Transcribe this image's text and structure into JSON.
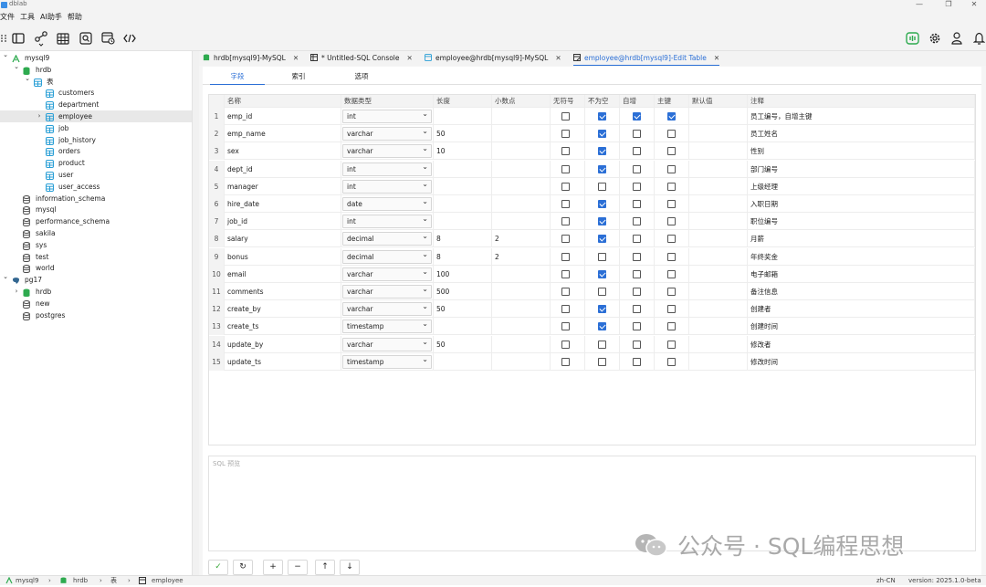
{
  "app": {
    "title": "dblab"
  },
  "window": {
    "minimize": "—",
    "maximize": "❐",
    "close": "✕"
  },
  "menu": [
    "文件",
    "工具",
    "AI助手",
    "帮助"
  ],
  "toolbar_icons": [
    "layout-icon",
    "connection-icon",
    "table-icon",
    "query-icon",
    "export-icon",
    "code-icon"
  ],
  "right_icons": [
    "ai-icon",
    "gear-icon",
    "user-icon",
    "bell-icon"
  ],
  "tree": [
    {
      "label": "mysql9",
      "level": 0,
      "arrow": "down",
      "icon": "connection"
    },
    {
      "label": "hrdb",
      "level": 1,
      "arrow": "down",
      "icon": "database"
    },
    {
      "label": "表",
      "level": 2,
      "arrow": "down",
      "icon": "table"
    },
    {
      "label": "customers",
      "level": 3,
      "arrow": "",
      "icon": "table"
    },
    {
      "label": "department",
      "level": 3,
      "arrow": "",
      "icon": "table"
    },
    {
      "label": "employee",
      "level": 3,
      "arrow": "right",
      "icon": "table",
      "selected": true
    },
    {
      "label": "job",
      "level": 3,
      "arrow": "",
      "icon": "table"
    },
    {
      "label": "job_history",
      "level": 3,
      "arrow": "",
      "icon": "table"
    },
    {
      "label": "orders",
      "level": 3,
      "arrow": "",
      "icon": "table"
    },
    {
      "label": "product",
      "level": 3,
      "arrow": "",
      "icon": "table"
    },
    {
      "label": "user",
      "level": 3,
      "arrow": "",
      "icon": "table"
    },
    {
      "label": "user_access",
      "level": 3,
      "arrow": "",
      "icon": "table"
    },
    {
      "label": "information_schema",
      "level": 1,
      "arrow": "",
      "icon": "db-gray"
    },
    {
      "label": "mysql",
      "level": 1,
      "arrow": "",
      "icon": "db-gray"
    },
    {
      "label": "performance_schema",
      "level": 1,
      "arrow": "",
      "icon": "db-gray"
    },
    {
      "label": "sakila",
      "level": 1,
      "arrow": "",
      "icon": "db-gray"
    },
    {
      "label": "sys",
      "level": 1,
      "arrow": "",
      "icon": "db-gray"
    },
    {
      "label": "test",
      "level": 1,
      "arrow": "",
      "icon": "db-gray"
    },
    {
      "label": "world",
      "level": 1,
      "arrow": "",
      "icon": "db-gray"
    },
    {
      "label": "pg17",
      "level": 0,
      "arrow": "down",
      "icon": "pg"
    },
    {
      "label": "hrdb",
      "level": 1,
      "arrow": "right",
      "icon": "database"
    },
    {
      "label": "new",
      "level": 1,
      "arrow": "",
      "icon": "db-gray"
    },
    {
      "label": "postgres",
      "level": 1,
      "arrow": "",
      "icon": "db-gray"
    }
  ],
  "tabs": [
    {
      "label": "hrdb[mysql9]-MySQL",
      "icon": "database",
      "active": false
    },
    {
      "label": "* Untitled-SQL Console",
      "icon": "console",
      "active": false
    },
    {
      "label": "employee@hrdb[mysql9]-MySQL",
      "icon": "table",
      "active": false
    },
    {
      "label": "employee@hrdb[mysql9]-Edit Table",
      "icon": "edit",
      "active": true
    }
  ],
  "subtabs": [
    "字段",
    "索引",
    "选项"
  ],
  "columns": [
    "名称",
    "数据类型",
    "长度",
    "小数点",
    "无符号",
    "不为空",
    "自增",
    "主键",
    "默认值",
    "注释"
  ],
  "fields": [
    {
      "n": "1",
      "name": "emp_id",
      "type": "int",
      "len": "",
      "dec": "",
      "uns": false,
      "nn": true,
      "ai": true,
      "pk": true,
      "def": "",
      "comment": "员工编号，自增主键"
    },
    {
      "n": "2",
      "name": "emp_name",
      "type": "varchar",
      "len": "50",
      "dec": "",
      "uns": false,
      "nn": true,
      "ai": false,
      "pk": false,
      "def": "",
      "comment": "员工姓名"
    },
    {
      "n": "3",
      "name": "sex",
      "type": "varchar",
      "len": "10",
      "dec": "",
      "uns": false,
      "nn": true,
      "ai": false,
      "pk": false,
      "def": "",
      "comment": "性别"
    },
    {
      "n": "4",
      "name": "dept_id",
      "type": "int",
      "len": "",
      "dec": "",
      "uns": false,
      "nn": true,
      "ai": false,
      "pk": false,
      "def": "",
      "comment": "部门编号"
    },
    {
      "n": "5",
      "name": "manager",
      "type": "int",
      "len": "",
      "dec": "",
      "uns": false,
      "nn": false,
      "ai": false,
      "pk": false,
      "def": "",
      "comment": "上级经理"
    },
    {
      "n": "6",
      "name": "hire_date",
      "type": "date",
      "len": "",
      "dec": "",
      "uns": false,
      "nn": true,
      "ai": false,
      "pk": false,
      "def": "",
      "comment": "入职日期"
    },
    {
      "n": "7",
      "name": "job_id",
      "type": "int",
      "len": "",
      "dec": "",
      "uns": false,
      "nn": true,
      "ai": false,
      "pk": false,
      "def": "",
      "comment": "职位编号"
    },
    {
      "n": "8",
      "name": "salary",
      "type": "decimal",
      "len": "8",
      "dec": "2",
      "uns": false,
      "nn": true,
      "ai": false,
      "pk": false,
      "def": "",
      "comment": "月薪"
    },
    {
      "n": "9",
      "name": "bonus",
      "type": "decimal",
      "len": "8",
      "dec": "2",
      "uns": false,
      "nn": false,
      "ai": false,
      "pk": false,
      "def": "",
      "comment": "年终奖金"
    },
    {
      "n": "10",
      "name": "email",
      "type": "varchar",
      "len": "100",
      "dec": "",
      "uns": false,
      "nn": true,
      "ai": false,
      "pk": false,
      "def": "",
      "comment": "电子邮箱"
    },
    {
      "n": "11",
      "name": "comments",
      "type": "varchar",
      "len": "500",
      "dec": "",
      "uns": false,
      "nn": false,
      "ai": false,
      "pk": false,
      "def": "",
      "comment": "备注信息"
    },
    {
      "n": "12",
      "name": "create_by",
      "type": "varchar",
      "len": "50",
      "dec": "",
      "uns": false,
      "nn": true,
      "ai": false,
      "pk": false,
      "def": "",
      "comment": "创建者"
    },
    {
      "n": "13",
      "name": "create_ts",
      "type": "timestamp",
      "len": "",
      "dec": "",
      "uns": false,
      "nn": true,
      "ai": false,
      "pk": false,
      "def": "",
      "comment": "创建时间"
    },
    {
      "n": "14",
      "name": "update_by",
      "type": "varchar",
      "len": "50",
      "dec": "",
      "uns": false,
      "nn": false,
      "ai": false,
      "pk": false,
      "def": "",
      "comment": "修改者"
    },
    {
      "n": "15",
      "name": "update_ts",
      "type": "timestamp",
      "len": "",
      "dec": "",
      "uns": false,
      "nn": false,
      "ai": false,
      "pk": false,
      "def": "",
      "comment": "修改时间"
    }
  ],
  "sql_preview": {
    "placeholder": "SQL 预览"
  },
  "actions": [
    "✓",
    "↻",
    "+",
    "−",
    "↑",
    "↓"
  ],
  "status": {
    "breadcrumb": [
      "mysql9",
      "hrdb",
      "表",
      "employee"
    ],
    "locale": "zh-CN",
    "version": "version: 2025.1.0-beta"
  },
  "watermark": "公众号 · SQL编程思想",
  "colors": {
    "accent": "#2b6fd6",
    "table_icon": "#2a9fd6",
    "db_icon": "#2eaa4f"
  }
}
